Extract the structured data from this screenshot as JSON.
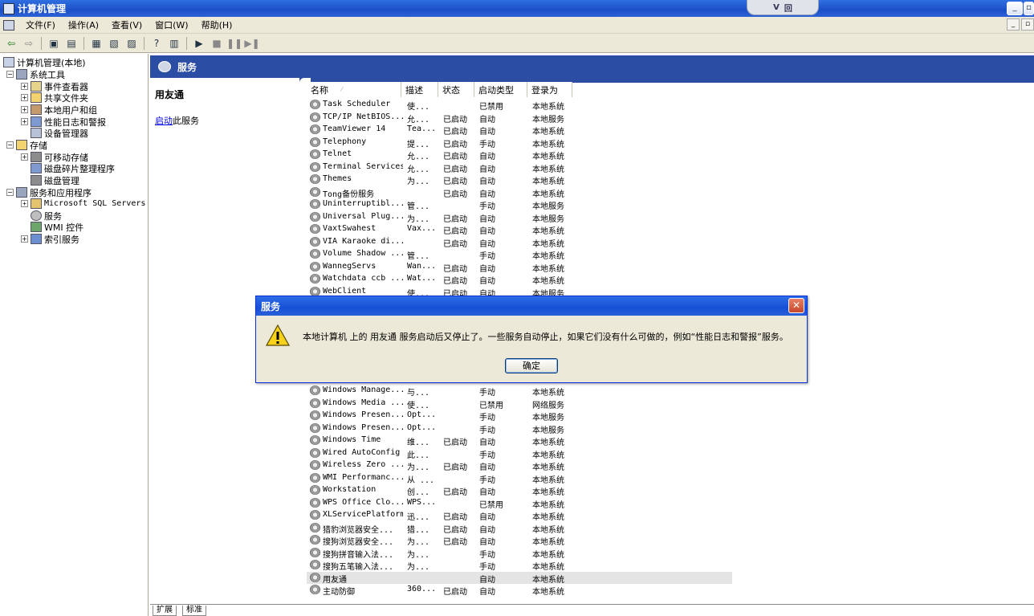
{
  "window": {
    "title": "计算机管理",
    "notch_text": "V",
    "notch_badge": "回"
  },
  "menu": {
    "items": [
      "文件(F)",
      "操作(A)",
      "查看(V)",
      "窗口(W)",
      "帮助(H)"
    ]
  },
  "toolbar": {
    "icons": [
      "back-icon",
      "forward-icon",
      "up-icon",
      "show-tree-icon",
      "export-icon",
      "properties-icon",
      "refresh-icon",
      "help-icon",
      "view-icon",
      "play-icon",
      "stop-icon",
      "pause-icon",
      "restart-icon"
    ]
  },
  "tree": {
    "root": "计算机管理(本地)",
    "system_tools": "系统工具",
    "event_viewer": "事件查看器",
    "shared_folders": "共享文件夹",
    "local_users": "本地用户和组",
    "perf_logs": "性能日志和警报",
    "device_manager": "设备管理器",
    "storage": "存储",
    "removable": "可移动存储",
    "defrag": "磁盘碎片整理程序",
    "disk_mgmt": "磁盘管理",
    "services_apps": "服务和应用程序",
    "sql": "Microsoft SQL Servers",
    "services": "服务",
    "wmi": "WMI 控件",
    "indexing": "索引服务"
  },
  "pane": {
    "header": "服务",
    "selected_service": "用友通",
    "start_link": "启动",
    "start_suffix": "此服务"
  },
  "columns": {
    "name": "名称",
    "desc": "描述",
    "status": "状态",
    "startup": "启动类型",
    "logon": "登录为"
  },
  "rows_top": [
    {
      "name": "Task Scheduler",
      "desc": "使...",
      "status": "",
      "startup": "已禁用",
      "logon": "本地系统"
    },
    {
      "name": "TCP/IP NetBIOS...",
      "desc": "允...",
      "status": "已启动",
      "startup": "自动",
      "logon": "本地服务"
    },
    {
      "name": "TeamViewer 14",
      "desc": "Tea...",
      "status": "已启动",
      "startup": "自动",
      "logon": "本地系统"
    },
    {
      "name": "Telephony",
      "desc": "提...",
      "status": "已启动",
      "startup": "手动",
      "logon": "本地系统"
    },
    {
      "name": "Telnet",
      "desc": "允...",
      "status": "已启动",
      "startup": "自动",
      "logon": "本地系统"
    },
    {
      "name": "Terminal Services",
      "desc": "允...",
      "status": "已启动",
      "startup": "自动",
      "logon": "本地系统"
    },
    {
      "name": "Themes",
      "desc": "为...",
      "status": "已启动",
      "startup": "自动",
      "logon": "本地系统"
    },
    {
      "name": "Tong备份服务",
      "desc": "",
      "status": "已启动",
      "startup": "自动",
      "logon": "本地系统"
    },
    {
      "name": "Uninterruptibl...",
      "desc": "管...",
      "status": "",
      "startup": "手动",
      "logon": "本地服务"
    },
    {
      "name": "Universal Plug...",
      "desc": "为...",
      "status": "已启动",
      "startup": "自动",
      "logon": "本地服务"
    },
    {
      "name": "VaxtSwahest",
      "desc": "Vax...",
      "status": "已启动",
      "startup": "自动",
      "logon": "本地系统"
    },
    {
      "name": "VIA Karaoke di...",
      "desc": "",
      "status": "已启动",
      "startup": "自动",
      "logon": "本地系统"
    },
    {
      "name": "Volume Shadow ...",
      "desc": "管...",
      "status": "",
      "startup": "手动",
      "logon": "本地系统"
    },
    {
      "name": "WannegServs",
      "desc": "Wan...",
      "status": "已启动",
      "startup": "自动",
      "logon": "本地系统"
    },
    {
      "name": "Watchdata ccb ...",
      "desc": "Wat...",
      "status": "已启动",
      "startup": "自动",
      "logon": "本地系统"
    },
    {
      "name": "WebClient",
      "desc": "使...",
      "status": "已启动",
      "startup": "自动",
      "logon": "本地服务"
    }
  ],
  "rows_bottom": [
    {
      "name": "Windows Manage...",
      "desc": "与...",
      "status": "",
      "startup": "手动",
      "logon": "本地系统"
    },
    {
      "name": "Windows Media ...",
      "desc": "使...",
      "status": "",
      "startup": "已禁用",
      "logon": "网络服务"
    },
    {
      "name": "Windows Presen...",
      "desc": "Opt...",
      "status": "",
      "startup": "手动",
      "logon": "本地服务"
    },
    {
      "name": "Windows Presen...",
      "desc": "Opt...",
      "status": "",
      "startup": "手动",
      "logon": "本地服务"
    },
    {
      "name": "Windows Time",
      "desc": "维...",
      "status": "已启动",
      "startup": "自动",
      "logon": "本地系统"
    },
    {
      "name": "Wired AutoConfig",
      "desc": "此...",
      "status": "",
      "startup": "手动",
      "logon": "本地系统"
    },
    {
      "name": "Wireless Zero ...",
      "desc": "为...",
      "status": "已启动",
      "startup": "自动",
      "logon": "本地系统"
    },
    {
      "name": "WMI Performanc...",
      "desc": "从 ...",
      "status": "",
      "startup": "手动",
      "logon": "本地系统"
    },
    {
      "name": "Workstation",
      "desc": "创...",
      "status": "已启动",
      "startup": "自动",
      "logon": "本地系统"
    },
    {
      "name": "WPS Office Clo...",
      "desc": "WPS...",
      "status": "",
      "startup": "已禁用",
      "logon": "本地系统"
    },
    {
      "name": "XLServicePlatform",
      "desc": "迅...",
      "status": "已启动",
      "startup": "自动",
      "logon": "本地系统"
    },
    {
      "name": "猎豹浏览器安全...",
      "desc": "猎...",
      "status": "已启动",
      "startup": "自动",
      "logon": "本地系统"
    },
    {
      "name": "搜狗浏览器安全...",
      "desc": "为...",
      "status": "已启动",
      "startup": "自动",
      "logon": "本地系统"
    },
    {
      "name": "搜狗拼音输入法...",
      "desc": "为...",
      "status": "",
      "startup": "手动",
      "logon": "本地系统"
    },
    {
      "name": "搜狗五笔输入法...",
      "desc": "为...",
      "status": "",
      "startup": "手动",
      "logon": "本地系统"
    },
    {
      "name": "用友通",
      "desc": "",
      "status": "",
      "startup": "自动",
      "logon": "本地系统",
      "selected": true
    },
    {
      "name": "主动防御",
      "desc": "360...",
      "status": "已启动",
      "startup": "自动",
      "logon": "本地系统"
    }
  ],
  "tabs": [
    "扩展",
    "标准"
  ],
  "dialog": {
    "title": "服务",
    "message": "本地计算机 上的 用友通 服务启动后又停止了。一些服务自动停止，如果它们没有什么可做的，例如“性能日志和警报”服务。",
    "ok": "确定",
    "close": "✕"
  },
  "colors": {
    "titlebar": "#1b4fc7",
    "header_band": "#2b4da3",
    "face": "#ece9d8",
    "link": "#0000ee"
  }
}
